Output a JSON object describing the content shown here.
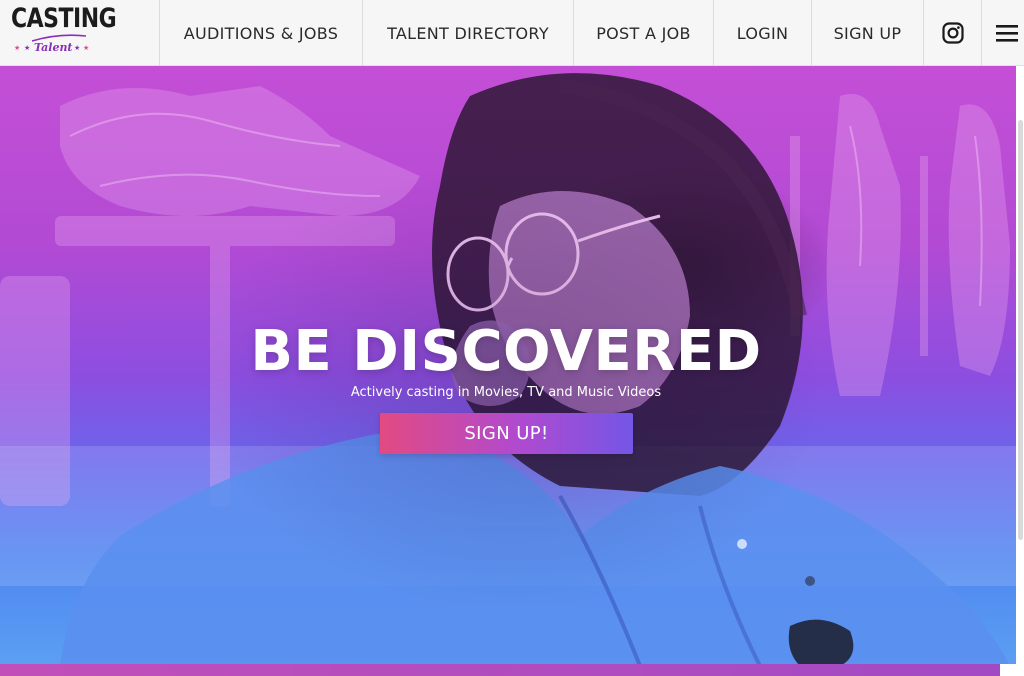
{
  "brand": {
    "logo_main": "CASTING",
    "logo_sub": "Talent",
    "logo_accent_color": "#8a2fb8"
  },
  "nav": {
    "items": [
      {
        "label": "AUDITIONS & JOBS"
      },
      {
        "label": "TALENT DIRECTORY"
      },
      {
        "label": "POST A JOB"
      },
      {
        "label": "LOGIN"
      },
      {
        "label": "SIGN UP"
      }
    ],
    "icons": [
      "instagram-icon",
      "menu-icon"
    ]
  },
  "hero": {
    "title": "BE DISCOVERED",
    "subtitle": "Actively casting in Movies, TV and Music Videos",
    "cta_label": "SIGN UP!",
    "gradient_colors": [
      "#c44fd6",
      "#8c4ee0",
      "#5b9ff2"
    ],
    "cta_colors": [
      "#e24a82",
      "#7456e6"
    ]
  }
}
